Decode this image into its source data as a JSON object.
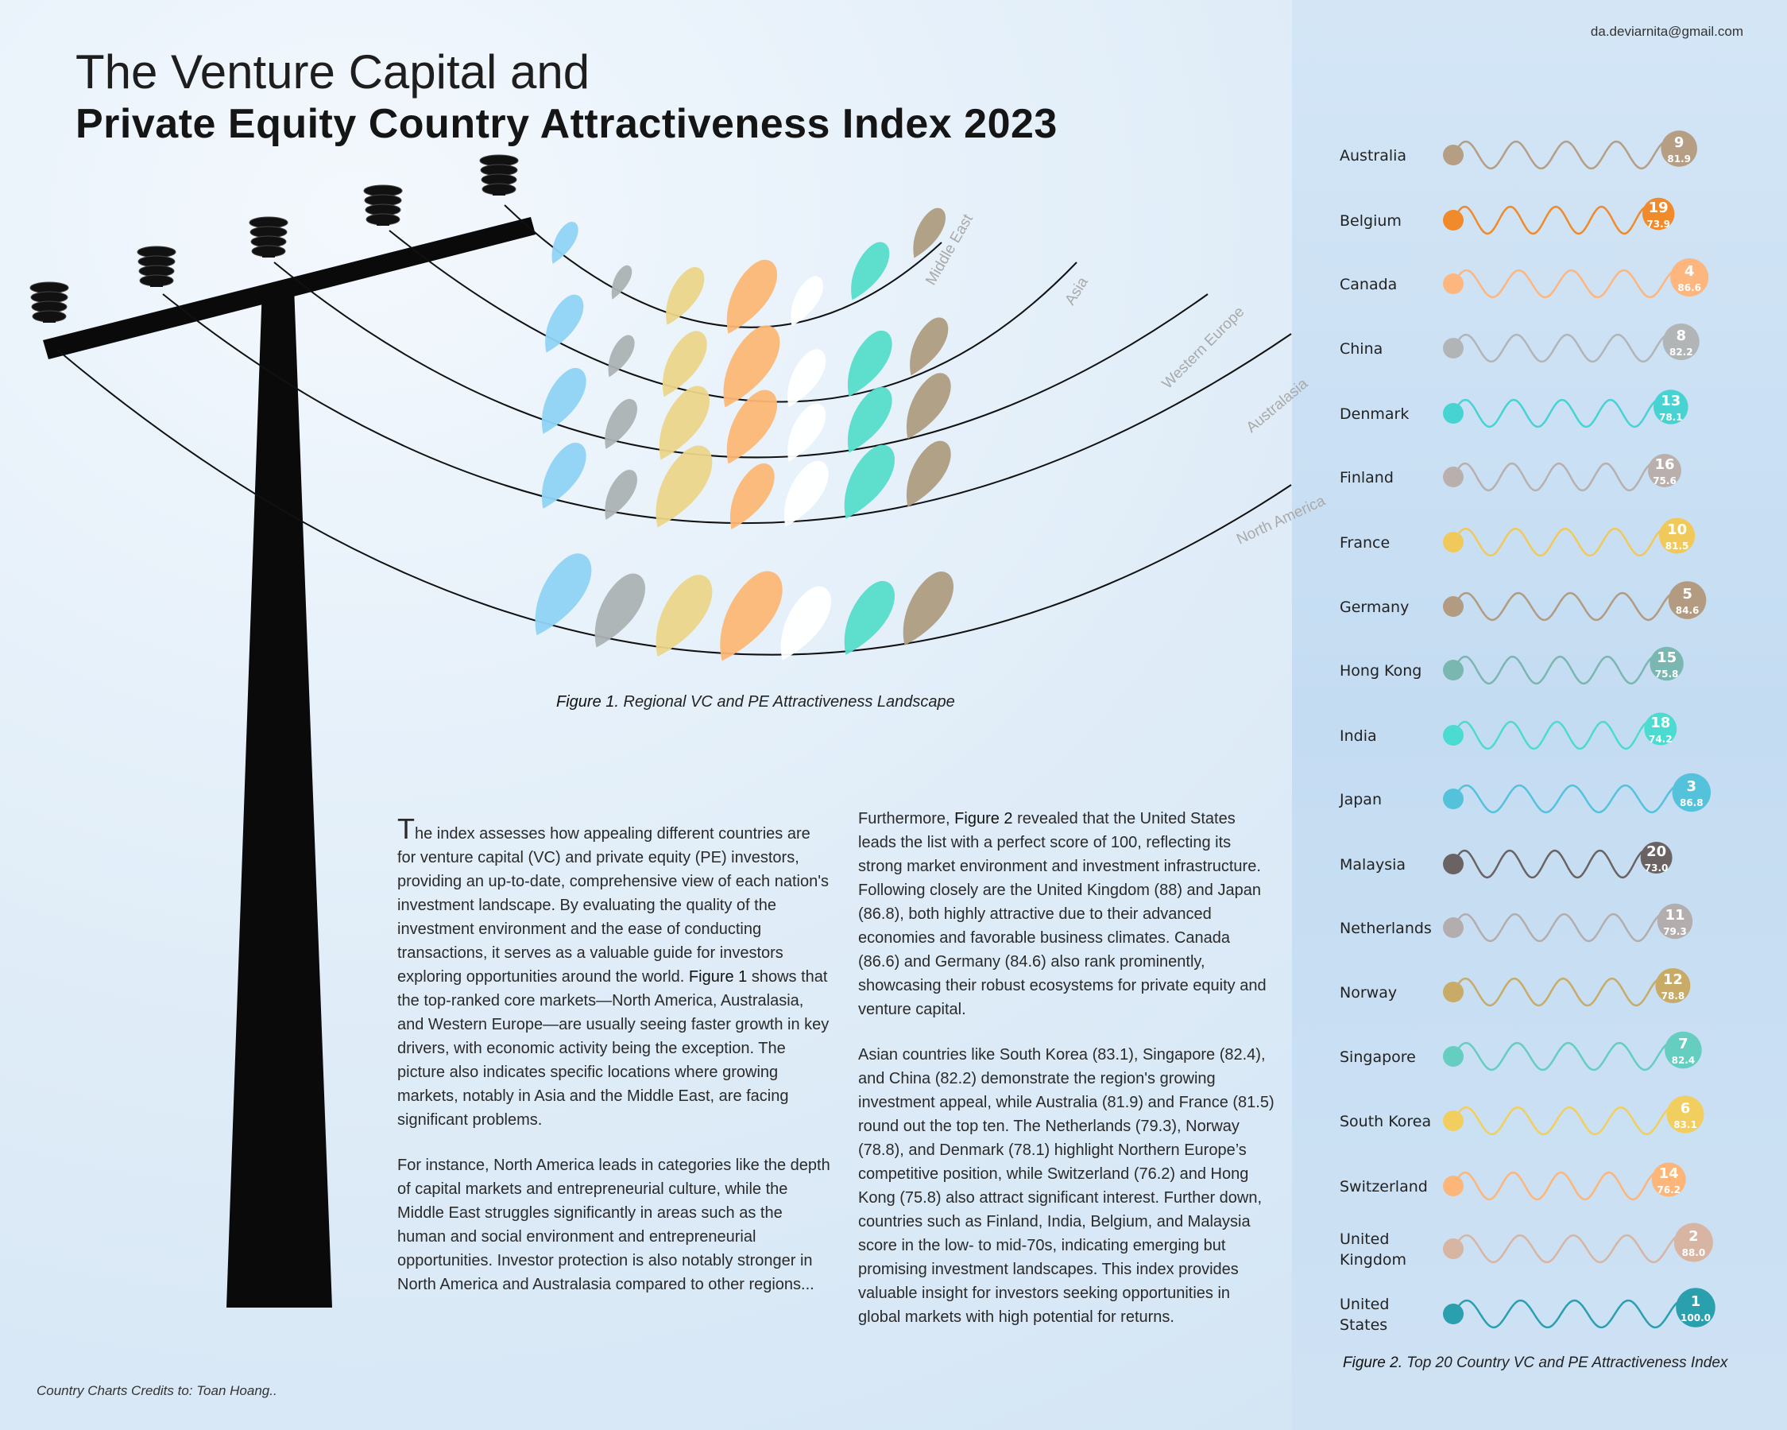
{
  "email": "da.deviarnita@gmail.com",
  "title_line1": "The Venture Capital and",
  "title_line2": "Private Equity Country Attractiveness Index 2023",
  "figure1": {
    "caption_label": "Figure 1.",
    "caption_text": " Regional VC and PE Attractiveness Landscape"
  },
  "figure2": {
    "caption_label": "Figure 2.",
    "caption_text": " Top 20 Country VC and PE Attractiveness Index"
  },
  "credits": "Country Charts Credits to: Toan Hoang..",
  "body": {
    "col1_p1_dropcap": "T",
    "col1_p1_a": "he index assesses how appealing different countries are for venture capital (VC) and private equity (PE) investors, providing an up-to-date, comprehensive view of each nation's investment landscape. By evaluating the quality of the investment environment and the ease of conducting transactions, it serves as a valuable guide for investors exploring opportunities around the world. ",
    "col1_p1_ref": "Figure 1",
    "col1_p1_b": " shows that the top-ranked core markets—North America, Australasia, and Western Europe—are usually seeing faster growth in key drivers, with economic activity being the exception. The picture also indicates specific locations where growing markets, notably in Asia and the Middle East, are facing significant problems.",
    "col1_p2": "For instance, North America leads in categories like the depth of capital markets and entrepreneurial culture, while the Middle East struggles significantly in areas such as the human and social environment and entrepreneurial opportunities. Investor protection is also notably stronger in North America and Australasia compared to other regions...",
    "col2_p1_a": "Furthermore, ",
    "col2_p1_ref": "Figure 2",
    "col2_p1_b": " revealed that the United States leads the list with a perfect score of 100, reflecting its strong market environment and investment infrastructure. Following closely are the United Kingdom (88) and Japan (86.8), both highly attractive due to their advanced economies and favorable business climates. Canada (86.6) and Germany (84.6) also rank prominently, showcasing their robust ecosystems for private equity and venture capital.",
    "col2_p2": "Asian countries like South Korea (83.1), Singapore (82.4), and China (82.2) demonstrate the region's growing investment appeal, while Australia (81.9) and France (81.5) round out the top ten. The Netherlands (79.3), Norway (78.8), and Denmark (78.1) highlight Northern Europe’s competitive position, while Switzerland (76.2) and Hong Kong (75.8) also attract significant interest. Further down, countries such as Finland, India, Belgium, and Malaysia score in the low- to mid-70s, indicating emerging but promising investment landscapes. This index provides valuable insight for investors seeking opportunities in global markets with high potential for returns."
  },
  "chart_data": [
    {
      "type": "other",
      "title": "Regional VC and PE Attractiveness Landscape",
      "series": [
        {
          "name": "Middle East",
          "values": [
            2,
            1,
            4,
            6,
            3,
            4,
            3
          ]
        },
        {
          "name": "Asia",
          "values": [
            4,
            2,
            5,
            7,
            4,
            5,
            4
          ]
        },
        {
          "name": "Western Europe",
          "values": [
            5,
            3,
            6,
            6,
            4,
            5,
            5
          ]
        },
        {
          "name": "Australasia",
          "values": [
            5,
            3,
            7,
            5,
            5,
            6,
            5
          ]
        },
        {
          "name": "North America",
          "values": [
            7,
            6,
            7,
            8,
            6,
            6,
            6
          ]
        }
      ],
      "colors": [
        "#8fd3f5",
        "#acb2b4",
        "#ecd58a",
        "#fcb776",
        "#ffffff",
        "#56ddcb",
        "#ae9c80"
      ]
    },
    {
      "type": "other",
      "title": "Top 20 Country VC and PE Attractiveness Index",
      "rows": [
        {
          "country": "Australia",
          "rank": 9,
          "score": "81.9",
          "color": "#b59e83"
        },
        {
          "country": "Belgium",
          "rank": 19,
          "score": "73.9",
          "color": "#f08a2a"
        },
        {
          "country": "Canada",
          "rank": 4,
          "score": "86.6",
          "color": "#fcb67e"
        },
        {
          "country": "China",
          "rank": 8,
          "score": "82.2",
          "color": "#b2b5b6"
        },
        {
          "country": "Denmark",
          "rank": 13,
          "score": "78.1",
          "color": "#47d3d1"
        },
        {
          "country": "Finland",
          "rank": 16,
          "score": "75.6",
          "color": "#b9b0ae"
        },
        {
          "country": "France",
          "rank": 10,
          "score": "81.5",
          "color": "#f1c95a"
        },
        {
          "country": "Germany",
          "rank": 5,
          "score": "84.6",
          "color": "#b29b80"
        },
        {
          "country": "Hong Kong",
          "rank": 15,
          "score": "75.8",
          "color": "#7ab7b0"
        },
        {
          "country": "India",
          "rank": 18,
          "score": "74.2",
          "color": "#4bdbd0"
        },
        {
          "country": "Japan",
          "rank": 3,
          "score": "86.8",
          "color": "#55c2dc"
        },
        {
          "country": "Malaysia",
          "rank": 20,
          "score": "73.0",
          "color": "#6b6363"
        },
        {
          "country": "Netherlands",
          "rank": 11,
          "score": "79.3",
          "color": "#b4adae"
        },
        {
          "country": "Norway",
          "rank": 12,
          "score": "78.8",
          "color": "#c7ab67"
        },
        {
          "country": "Singapore",
          "rank": 7,
          "score": "82.4",
          "color": "#66cdc1"
        },
        {
          "country": "South Korea",
          "rank": 6,
          "score": "83.1",
          "color": "#f1ce5e"
        },
        {
          "country": "Switzerland",
          "rank": 14,
          "score": "76.2",
          "color": "#fcb679"
        },
        {
          "country": "United Kingdom",
          "rank": 2,
          "score": "88.0",
          "color": "#d8b4a2"
        },
        {
          "country": "United States",
          "rank": 1,
          "score": "100.0",
          "color": "#2a9fae"
        }
      ]
    }
  ]
}
